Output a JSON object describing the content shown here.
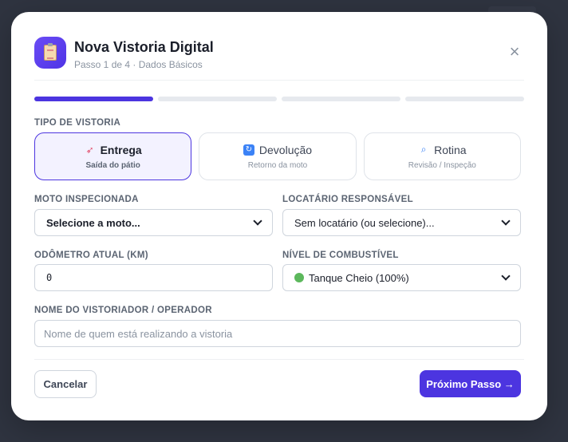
{
  "header": {
    "title": "Nova Vistoria Digital",
    "subtitle": "Passo 1 de 4 · Dados Básicos",
    "icon": "clipboard-icon",
    "close": "×"
  },
  "stepper": {
    "total": 4,
    "current": 1,
    "accent": "#4c35e0"
  },
  "tipo": {
    "label": "TIPO DE VISTORIA",
    "options": [
      {
        "icon": "🚀",
        "icon_name": "rocket-icon",
        "title": "Entrega",
        "sub": "Saída do pátio",
        "selected": true
      },
      {
        "icon": "🔄",
        "icon_name": "sync-icon",
        "title": "Devolução",
        "sub": "Retorno da moto",
        "selected": false
      },
      {
        "icon": "🔍",
        "icon_name": "magnifier-icon",
        "title": "Rotina",
        "sub": "Revisão / Inspeção",
        "selected": false
      }
    ]
  },
  "moto": {
    "label": "MOTO INSPECIONADA",
    "value": "Selecione a moto..."
  },
  "locatario": {
    "label": "LOCATÁRIO RESPONSÁVEL",
    "value": "Sem locatário (ou selecione)..."
  },
  "odometro": {
    "label": "ODÔMETRO ATUAL (KM)",
    "value": "0"
  },
  "combustivel": {
    "label": "NÍVEL DE COMBUSTÍVEL",
    "value": "Tanque Cheio (100%)",
    "icon_name": "fuel-full-icon"
  },
  "vistoriador": {
    "label": "NOME DO VISTORIADOR / OPERADOR",
    "placeholder": "Nome de quem está realizando a vistoria",
    "value": ""
  },
  "footer": {
    "cancel": "Cancelar",
    "next": "Próximo Passo →"
  }
}
